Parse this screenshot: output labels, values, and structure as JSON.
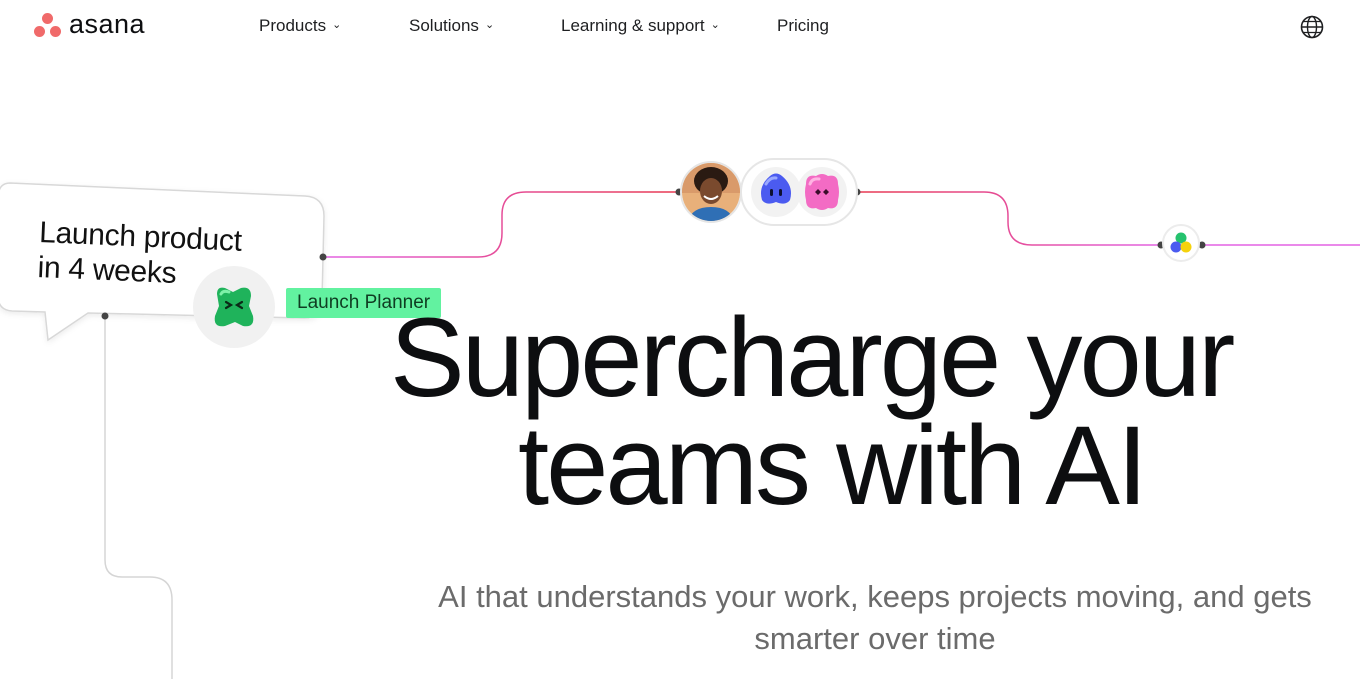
{
  "nav": {
    "brand": "asana",
    "items": [
      {
        "label": "Products",
        "has_menu": true
      },
      {
        "label": "Solutions",
        "has_menu": true
      },
      {
        "label": "Learning & support",
        "has_menu": true
      },
      {
        "label": "Pricing",
        "has_menu": false
      }
    ],
    "globe_icon": "globe-icon"
  },
  "hero": {
    "bubble_line1": "Launch product",
    "bubble_line2": "in 4 weeks",
    "tag_label": "Launch Planner",
    "headline_line1": "Supercharge your",
    "headline_line2": "teams with AI",
    "subtitle": "AI that understands your work, keeps projects moving, and gets smarter over time"
  },
  "colors": {
    "brand_coral": "#f06a6a",
    "tag_green": "#62f2a0",
    "line_red": "#e8384f",
    "line_pink": "#e362e3"
  }
}
